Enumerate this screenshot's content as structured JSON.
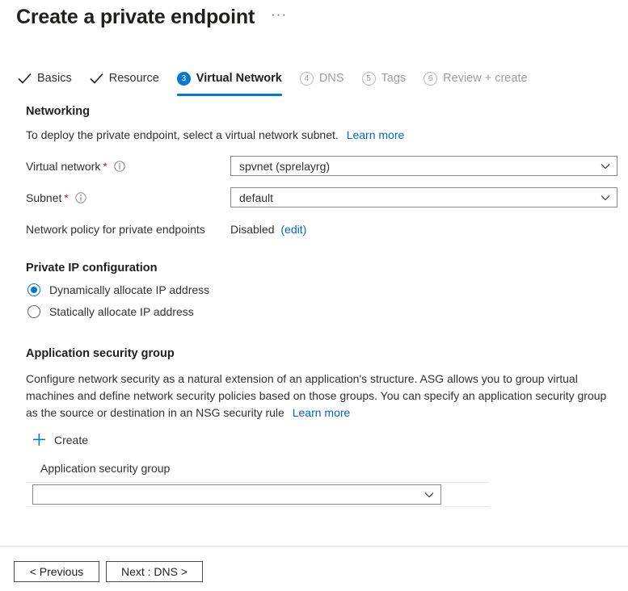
{
  "header": {
    "title": "Create a private endpoint",
    "more_menu": "···"
  },
  "tabs": [
    {
      "label": "Basics",
      "marker": "check",
      "state": "complete"
    },
    {
      "label": "Resource",
      "marker": "check",
      "state": "complete"
    },
    {
      "label": "Virtual Network",
      "marker": "3",
      "state": "active"
    },
    {
      "label": "DNS",
      "marker": "4",
      "state": "disabled"
    },
    {
      "label": "Tags",
      "marker": "5",
      "state": "disabled"
    },
    {
      "label": "Review + create",
      "marker": "6",
      "state": "disabled"
    }
  ],
  "networking": {
    "heading": "Networking",
    "description": "To deploy the private endpoint, select a virtual network subnet.",
    "learn_more": "Learn more",
    "virtual_network": {
      "label": "Virtual network",
      "required": "*",
      "value": "spvnet (sprelayrg)"
    },
    "subnet": {
      "label": "Subnet",
      "required": "*",
      "value": "default"
    },
    "network_policy": {
      "label": "Network policy for private endpoints",
      "value": "Disabled",
      "edit_link": "(edit)"
    }
  },
  "private_ip": {
    "heading": "Private IP configuration",
    "options": [
      {
        "label": "Dynamically allocate IP address",
        "selected": true
      },
      {
        "label": "Statically allocate IP address",
        "selected": false
      }
    ]
  },
  "asg": {
    "heading": "Application security group",
    "description": "Configure network security as a natural extension of an application's structure. ASG allows you to group virtual machines and define network security policies based on those groups. You can specify an application security group as the source or destination in an NSG security rule",
    "learn_more": "Learn more",
    "create_label": "Create",
    "column_header": "Application security group",
    "selected_value": ""
  },
  "footer": {
    "previous_label": "< Previous",
    "next_label": "Next : DNS >"
  },
  "colors": {
    "accent": "#0078d4",
    "link": "#0066cc",
    "required": "#a4262c",
    "disabled_text": "#a19f9d",
    "text": "#323130"
  }
}
